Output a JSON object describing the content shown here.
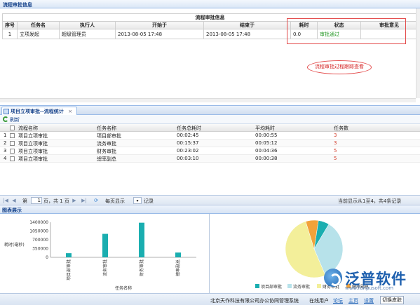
{
  "approval_panel": {
    "title": "流程审批信息",
    "caption": "流程审批信息",
    "columns": [
      "序号",
      "任务名",
      "执行人",
      "开始于",
      "结束于",
      "耗时",
      "状态",
      "审批意见"
    ],
    "rows": [
      {
        "index": "1",
        "task": "立项发起",
        "executor": "超级管理员",
        "start": "2013-08-05 17:48",
        "end": "2013-08-05 17:48",
        "duration": "0.0",
        "status": "审批通过",
        "opinion": ""
      }
    ],
    "callout_text": "流程审批过程跟踪查看",
    "callout_color": "#e34a4a"
  },
  "tab": {
    "label": "项目立项审批--流程统计",
    "close": "×"
  },
  "toolbar": {
    "refresh_label": "刷新"
  },
  "grid": {
    "columns": [
      "流程名称",
      "任务名称",
      "任务总耗时",
      "平均耗时",
      "任务数"
    ],
    "rows": [
      {
        "row": "1",
        "process": "项目立项审批",
        "task": "项目部审批",
        "total": "00:02:45",
        "avg": "00:00:55",
        "count": "3"
      },
      {
        "row": "2",
        "process": "项目立项审批",
        "task": "流务审批",
        "total": "00:15:37",
        "avg": "00:05:12",
        "count": "3"
      },
      {
        "row": "3",
        "process": "项目立项审批",
        "task": "财务审批",
        "total": "00:23:02",
        "avg": "00:04:36",
        "count": "5"
      },
      {
        "row": "4",
        "process": "项目立项审批",
        "task": "總率副总",
        "total": "00:03:10",
        "avg": "00:00:38",
        "count": "5"
      }
    ],
    "count_color": "#d23c2a"
  },
  "pager": {
    "first": "|◀",
    "prev": "◀",
    "page_label": "第",
    "page_value": "1",
    "page_total": "页，共 1 页",
    "next": "▶",
    "last": "▶|",
    "per_page_label": "每页显示",
    "per_page_value": "▾",
    "records_label": "记录",
    "summary": "当前显示从1至4，共4条记录"
  },
  "chart_panel": {
    "title": "图表展示"
  },
  "chart_data": [
    {
      "type": "bar",
      "title": "",
      "xlabel": "任务名称",
      "ylabel": "耗时(毫秒)",
      "ylim": [
        0,
        1400000
      ],
      "yticks": [
        "1400000",
        "1050000",
        "700000",
        "350000",
        "0"
      ],
      "categories": [
        "项目部审批",
        "流务审批",
        "财务审批",
        "總率副总"
      ],
      "values": [
        165000,
        937000,
        1382000,
        190000
      ],
      "color": "#1aaeb0"
    },
    {
      "type": "pie",
      "title": "",
      "categories": [
        "项目部审批",
        "流务审批",
        "财务审批",
        "總率副总"
      ],
      "values": [
        165000,
        937000,
        1382000,
        190000
      ],
      "colors": [
        "#1aaeb0",
        "#b7e2ea",
        "#f3ef9a",
        "#f2a23a"
      ]
    }
  ],
  "statusbar": {
    "company": "北京天作科技有限公司办公协同管理系统",
    "online_label": "在线用户",
    "forum": "论坛",
    "homepage": "主页",
    "settings": "设置",
    "switch_skin": "切换皮肤"
  },
  "logo": {
    "text": "泛普软件",
    "url": "www.fanpusoft.com"
  }
}
